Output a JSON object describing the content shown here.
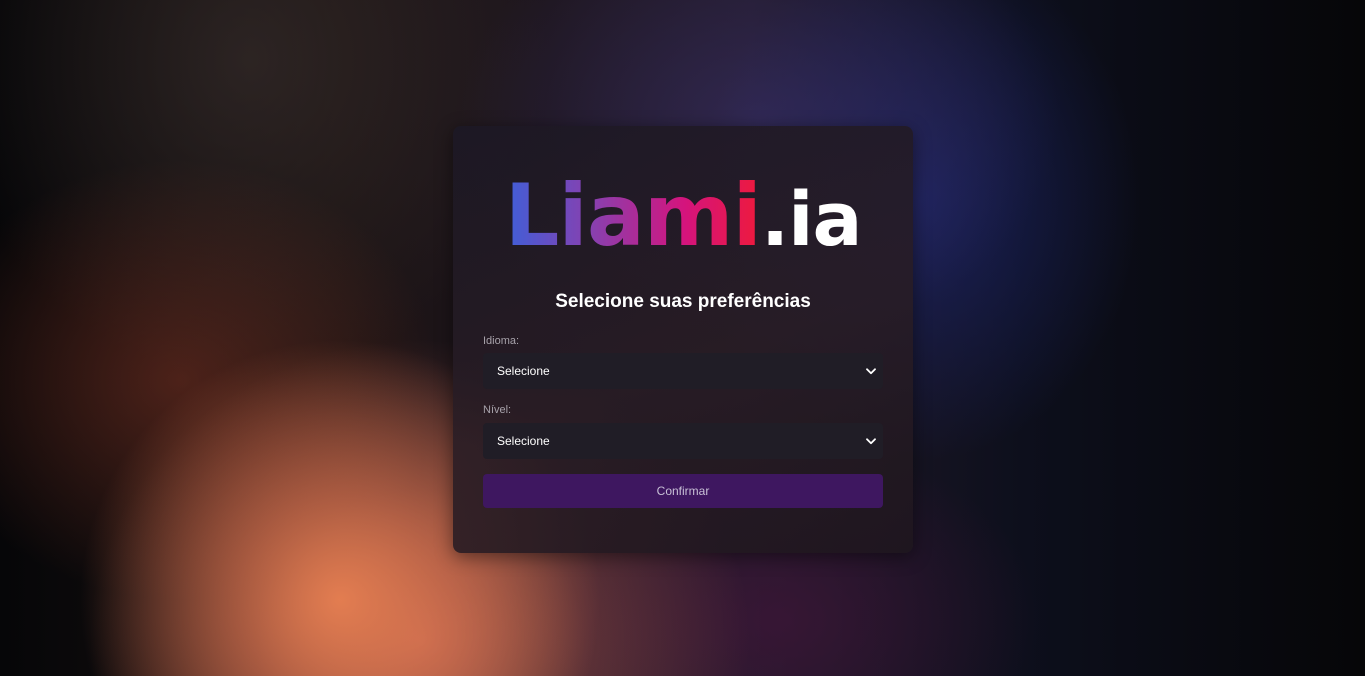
{
  "logo": {
    "main": "Liami",
    "suffix": ".ia"
  },
  "title": "Selecione suas preferências",
  "fields": [
    {
      "label": "Idioma:",
      "selected": "Selecione",
      "icon": "chevron-down-icon"
    },
    {
      "label": "Nível:",
      "selected": "Selecione",
      "icon": "chevron-down-icon"
    }
  ],
  "confirm_label": "Confirmar",
  "colors": {
    "logo_gradient": [
      "#3f5fd8",
      "#8a3fae",
      "#d4147d",
      "#ee1a3c"
    ],
    "button_bg": "#3e1760",
    "select_bg": "#201d26"
  }
}
